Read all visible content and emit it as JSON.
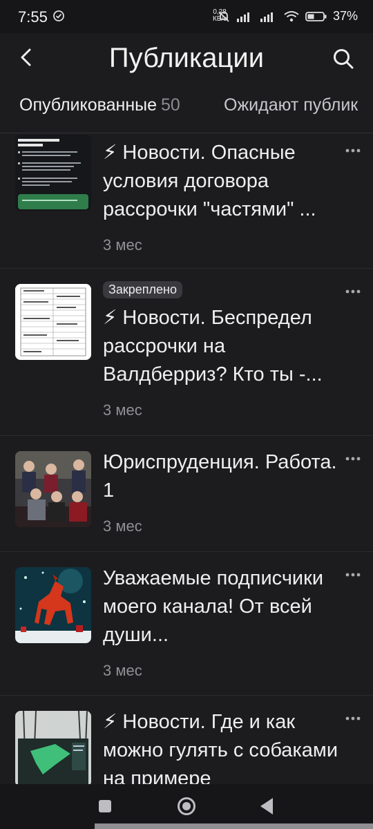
{
  "status": {
    "time": "7:55",
    "speed_value": "0,28",
    "speed_unit": "КБ/с",
    "battery": "37%"
  },
  "appbar": {
    "title": "Публикации",
    "back_icon": "back-arrow-icon",
    "search_icon": "search-icon"
  },
  "tabs": [
    {
      "label": "Опубликованные",
      "count": "50"
    },
    {
      "label": "Ожидают публик"
    }
  ],
  "posts": [
    {
      "title": "⚡ Новости. Опасные условия договора рассрочки \"частями\" ...",
      "time": "3 мес",
      "badge": ""
    },
    {
      "title": "⚡ Новости. Беспредел рассрочки на Валдберриз? Кто ты -...",
      "time": "3 мес",
      "badge": "Закреплено"
    },
    {
      "title": "Юриспруденция. Работа. 1",
      "time": "3 мес",
      "badge": ""
    },
    {
      "title": "Уважаемые подписчики моего канала! От всей души...",
      "time": "3 мес",
      "badge": ""
    },
    {
      "title": "⚡ Новости. Где и как можно гулять с собаками на примере",
      "time": "",
      "badge": ""
    }
  ],
  "colors": {
    "background": "#1c1c1e",
    "text": "#efeff2",
    "secondary": "#909095",
    "badge_bg": "#3a3a3e"
  }
}
